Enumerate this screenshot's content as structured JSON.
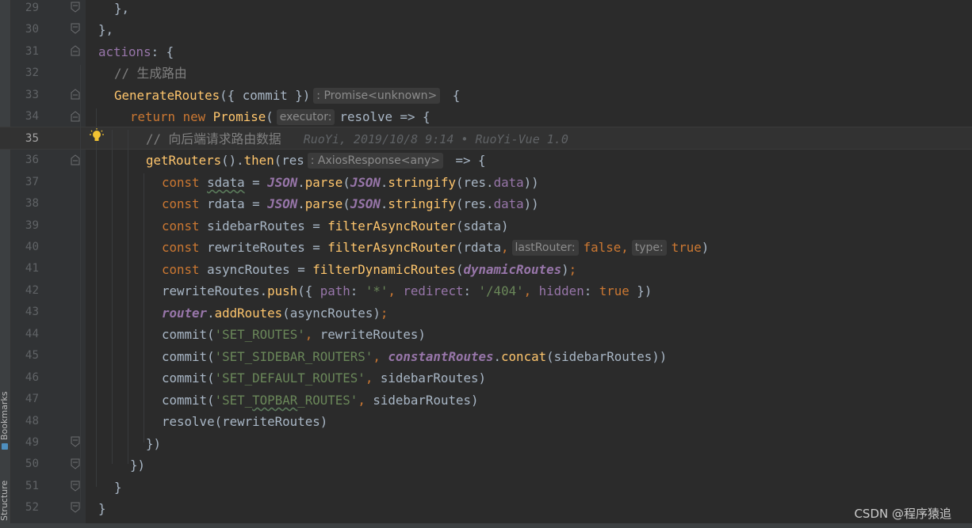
{
  "tool_windows": {
    "bookmarks_label": "Bookmarks",
    "structure_label": "Structure"
  },
  "editor": {
    "current_line": 35,
    "hint_executor": "executor:",
    "hint_promise_type": ": Promise<unknown>",
    "hint_res_type": ": AxiosResponse<any>",
    "hint_last_router": "lastRouter:",
    "hint_type": "type:",
    "blame": "RuoYi, 2019/10/8 9:14 • RuoYi-Vue 1.0",
    "line_numbers": [
      "29",
      "30",
      "31",
      "32",
      "33",
      "34",
      "35",
      "36",
      "37",
      "38",
      "39",
      "40",
      "41",
      "42",
      "43",
      "44",
      "45",
      "46",
      "47",
      "48",
      "49",
      "50",
      "51",
      "52"
    ],
    "lines": {
      "l29": "},",
      "l30": "},",
      "l31_key": "actions",
      "l31_rest": ": {",
      "l32": "// 生成路由",
      "l33_fn": "GenerateRoutes",
      "l33_args": "({ commit })",
      "l33_end": " {",
      "l34_return": "return",
      "l34_new": "new",
      "l34_promise": "Promise",
      "l34_paren": "(",
      "l34_rest": "resolve => {",
      "l35": "// 向后端请求路由数据",
      "l36_fn": "getRouters",
      "l36_mid": "().",
      "l36_then": "then",
      "l36_res": "(res",
      "l36_end": " => {",
      "l37_const": "const",
      "l37_var": "sdata",
      "l37_eq": " = ",
      "l37_json": "JSON",
      "l37_dot": ".",
      "l37_parse": "parse",
      "l37_p1": "(",
      "l37_json2": "JSON",
      "l37_dot2": ".",
      "l37_stringify": "stringify",
      "l37_p2": "(res.",
      "l37_data": "data",
      "l37_p3": "))",
      "l38_var": "rdata",
      "l39_rest": " sidebarRoutes = ",
      "l39_fn": "filterAsyncRouter",
      "l39_args": "(sdata)",
      "l40_rest": " rewriteRoutes = ",
      "l40_fn": "filterAsyncRouter",
      "l40_a1": "(rdata",
      "l40_c1": ",",
      "l40_false": "false",
      "l40_c2": ",",
      "l40_true": "true",
      "l40_end": ")",
      "l41_rest": " asyncRoutes = ",
      "l41_fn": "filterDynamicRoutes",
      "l41_p": "(",
      "l41_glob": "dynamicRoutes",
      "l41_end": ")",
      "l41_semi": ";",
      "l42_obj": "rewriteRoutes.",
      "l42_push": "push",
      "l42_open": "({ ",
      "l42_path": "path",
      "l42_c": ": ",
      "l42_star": "'*'",
      "l42_comma": ", ",
      "l42_redirect": "redirect",
      "l42_c2": ": ",
      "l42_404": "'/404'",
      "l42_comma2": ", ",
      "l42_hidden": "hidden",
      "l42_c3": ": ",
      "l42_true": "true",
      "l42_end": " })",
      "l43_router": "router",
      "l43_dot": ".",
      "l43_add": "addRoutes",
      "l43_args": "(asyncRoutes)",
      "l43_semi": ";",
      "commit": "commit",
      "l44_str": "'SET_ROUTES'",
      "l44_rest": " rewriteRoutes)",
      "l45_str": "'SET_SIDEBAR_ROUTERS'",
      "l45_glob": "constantRoutes",
      "l45_dot": ".",
      "l45_concat": "concat",
      "l45_rest": "(sidebarRoutes))",
      "l46_str": "'SET_DEFAULT_ROUTES'",
      "l46_rest": " sidebarRoutes)",
      "l47_str_a": "'SET_",
      "l47_str_b": "TOPBAR",
      "l47_str_c": "_ROUTES'",
      "l47_rest": " sidebarRoutes)",
      "l48": "resolve(rewriteRoutes)",
      "l49": "})",
      "l50": "})",
      "l51": "}",
      "l52": "}"
    }
  },
  "watermark": "CSDN @程序猿追"
}
